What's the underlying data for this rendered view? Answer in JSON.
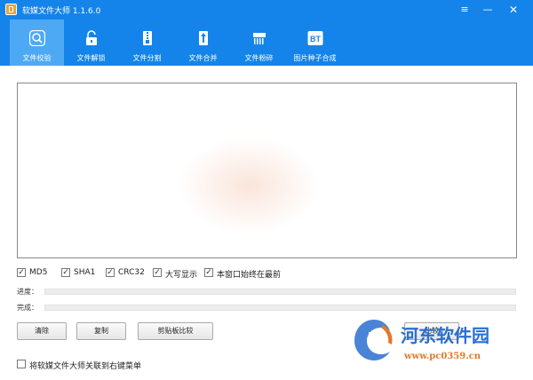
{
  "window": {
    "title": "软媒文件大师 1.1.6.0"
  },
  "titlebar": {
    "menu_glyph": "≡",
    "minimize_glyph": "—",
    "close_glyph": "✕"
  },
  "tabs": [
    {
      "label": "文件校验",
      "icon": "magnifier-icon",
      "active": true
    },
    {
      "label": "文件解锁",
      "icon": "unlock-icon",
      "active": false
    },
    {
      "label": "文件分割",
      "icon": "zip-icon",
      "active": false
    },
    {
      "label": "文件合并",
      "icon": "merge-icon",
      "active": false
    },
    {
      "label": "文件粉碎",
      "icon": "shredder-icon",
      "active": false
    },
    {
      "label": "图片种子合成",
      "icon": "bt-icon",
      "active": false,
      "badge": "BT"
    }
  ],
  "output": {
    "value": ""
  },
  "options": [
    {
      "label": "MD5",
      "checked": true
    },
    {
      "label": "SHA1",
      "checked": true
    },
    {
      "label": "CRC32",
      "checked": true
    },
    {
      "label": "大写显示",
      "checked": true
    },
    {
      "label": "本窗口始终在最前",
      "checked": true
    }
  ],
  "progress": {
    "label": "进度：",
    "value": 0
  },
  "complete": {
    "label": "完成：",
    "value": 0
  },
  "buttons": {
    "clear": "清除",
    "copy": "复制",
    "clipboard_compare": "剪贴板比较",
    "partial": "比较"
  },
  "footer": {
    "context_menu_label": "将软媒文件大师关联到右键菜单",
    "checked": false
  },
  "watermark": {
    "name": "河东软件园",
    "url": "www.pc0359.cn"
  },
  "colors": {
    "accent": "#1484ea",
    "active_tab": "#4ea9f5",
    "watermark_blue": "#2a6fd0",
    "watermark_orange": "#e07a2b"
  }
}
